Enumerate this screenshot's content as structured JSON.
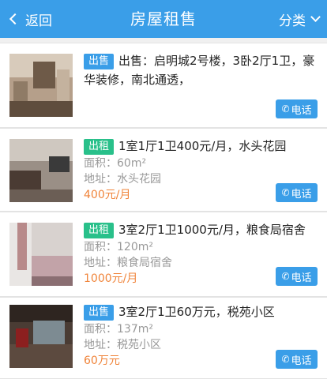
{
  "navbar": {
    "back_label": "返回",
    "title": "房屋租售",
    "category_label": "分类"
  },
  "listings": [
    {
      "badge": "出售",
      "badge_type": "sale",
      "title": "出售：启明城2号楼，3卧2厅1卫，豪华装修，南北通透，",
      "area": "",
      "address": "",
      "price": "",
      "call_label": "电话"
    },
    {
      "badge": "出租",
      "badge_type": "rent",
      "title": "1室1厅1卫400元/月，水头花园",
      "area": "面积：60m²",
      "address": "地址：水头花园",
      "price": "400元/月",
      "call_label": "电话"
    },
    {
      "badge": "出租",
      "badge_type": "rent",
      "title": "3室2厅1卫1000元/月，粮食局宿舍",
      "area": "面积：120m²",
      "address": "地址：粮食局宿舍",
      "price": "1000元/月",
      "call_label": "电话"
    },
    {
      "badge": "出售",
      "badge_type": "sale",
      "title": "3室2厅1卫60万元，税苑小区",
      "area": "面积：137m²",
      "address": "地址：税苑小区",
      "price": "60万元",
      "call_label": "电话"
    }
  ],
  "colors": {
    "primary": "#3a9ee8",
    "rent_badge": "#29c08a",
    "price": "#f0843a"
  },
  "icons": {
    "back": "chevron-left-icon",
    "category": "chevron-down-icon",
    "call": "phone-icon"
  }
}
